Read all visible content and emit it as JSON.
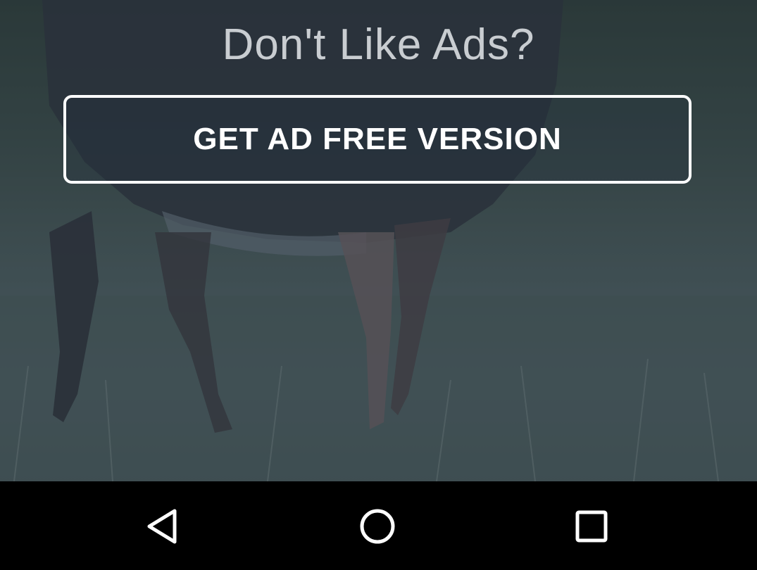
{
  "promo": {
    "headline": "Don't Like Ads?",
    "cta_label": "GET AD FREE VERSION"
  },
  "navbar": {
    "icons": [
      "back-icon",
      "home-icon",
      "recents-icon"
    ]
  },
  "colors": {
    "headline": "#c9cdd1",
    "cta_border": "#ffffff",
    "navbar_bg": "#000000"
  }
}
